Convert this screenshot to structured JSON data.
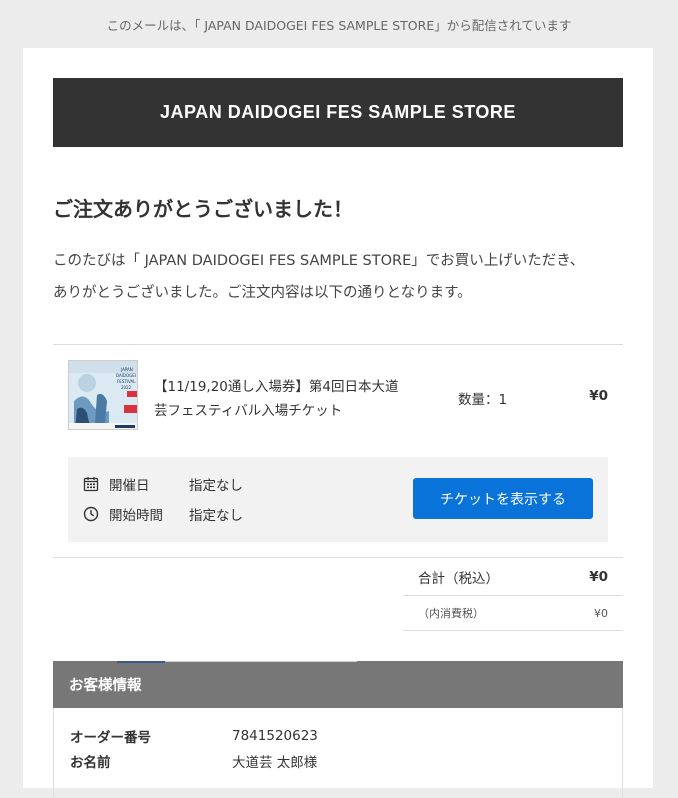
{
  "notice": "このメールは、「 JAPAN DAIDOGEI FES SAMPLE STORE」から配信されています",
  "store_name": "JAPAN DAIDOGEI FES SAMPLE STORE",
  "thanks_heading": "ご注文ありがとうございました！",
  "intro_line1": "このたびは「 JAPAN DAIDOGEI FES SAMPLE STORE」でお買い上げいただき、",
  "intro_line2": "ありがとうございました。ご注文内容は以下の通りとなります。",
  "order_item": {
    "name": "【11/19,20通し入場券】第4回日本大道芸フェスティバル入場チケット",
    "quantity_label": "数量：",
    "quantity": "1",
    "price": "¥0",
    "thumbnail": {
      "brand_line": "JAPAN",
      "brand_line2": "DAIDOGEI",
      "brand_line3": "FESTIVAL",
      "year": "2022"
    }
  },
  "event_info": {
    "date_label": "開催日",
    "date_value": "指定なし",
    "time_label": "開始時間",
    "time_value": "指定なし",
    "ticket_button": "チケットを表示する"
  },
  "totals": {
    "total_label": "合計（税込）",
    "total_value": "¥0",
    "tax_label": "（内消費税）",
    "tax_value": "¥0"
  },
  "customer": {
    "section_title": "お客様情報",
    "order_number_label": "オーダー番号",
    "order_number": "7841520623",
    "name_label": "お名前",
    "name_value": "大道芸 太郎様"
  },
  "colors": {
    "header_bg": "#333333",
    "button_bg": "#0a73d9",
    "section_bg": "#777777",
    "tab_accent": "#3a5a8c"
  }
}
